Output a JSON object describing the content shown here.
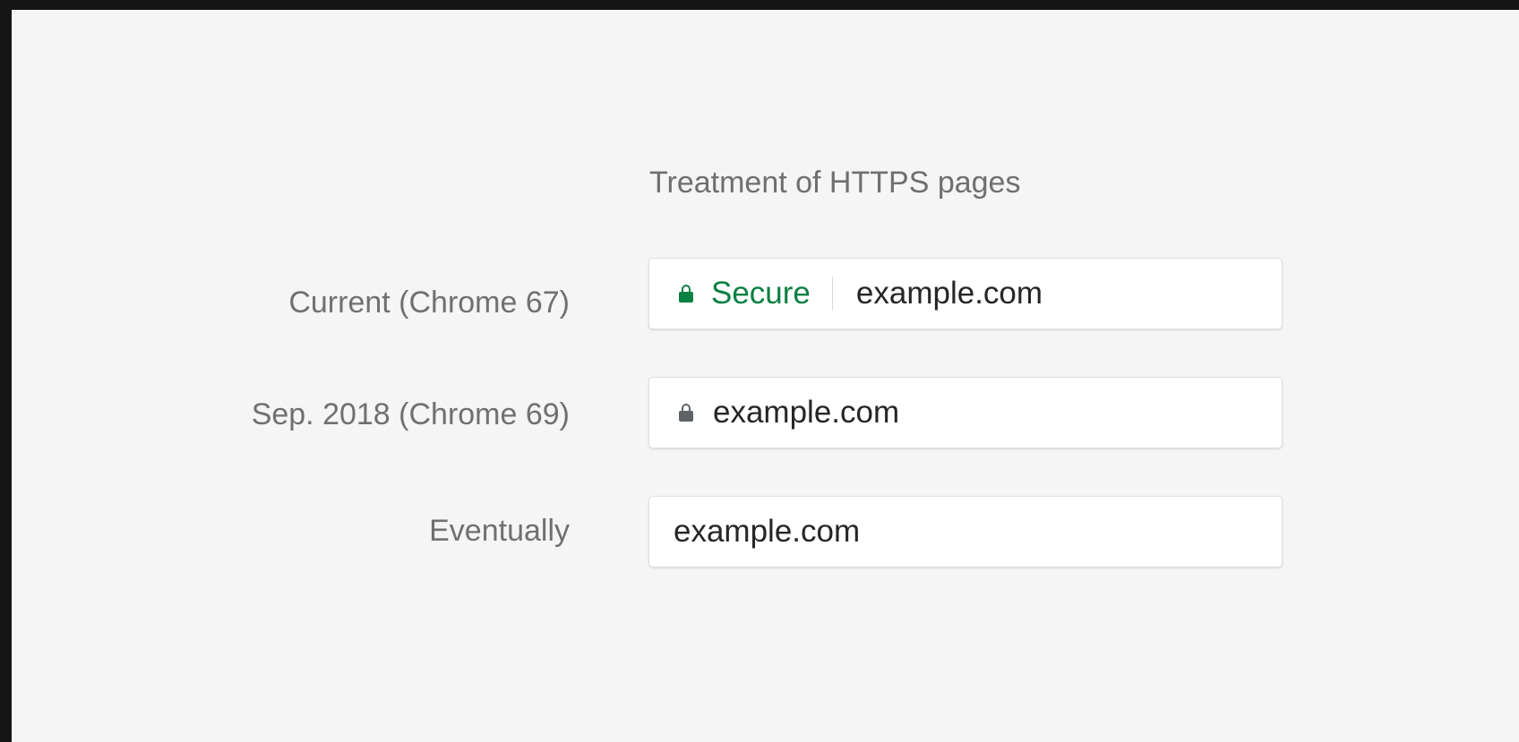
{
  "heading": "Treatment of HTTPS pages",
  "rows": [
    {
      "label": "Current (Chrome 67)",
      "lock_icon": "lock-icon",
      "lock_color": "#0b8043",
      "security_text": "Secure",
      "url": "example.com"
    },
    {
      "label": "Sep. 2018 (Chrome 69)",
      "lock_icon": "lock-icon",
      "lock_color": "#5f6368",
      "url": "example.com"
    },
    {
      "label": "Eventually",
      "url": "example.com"
    }
  ],
  "colors": {
    "secure_green": "#0b8043",
    "panel_background": "#f5f5f5",
    "frame": "#161616"
  }
}
